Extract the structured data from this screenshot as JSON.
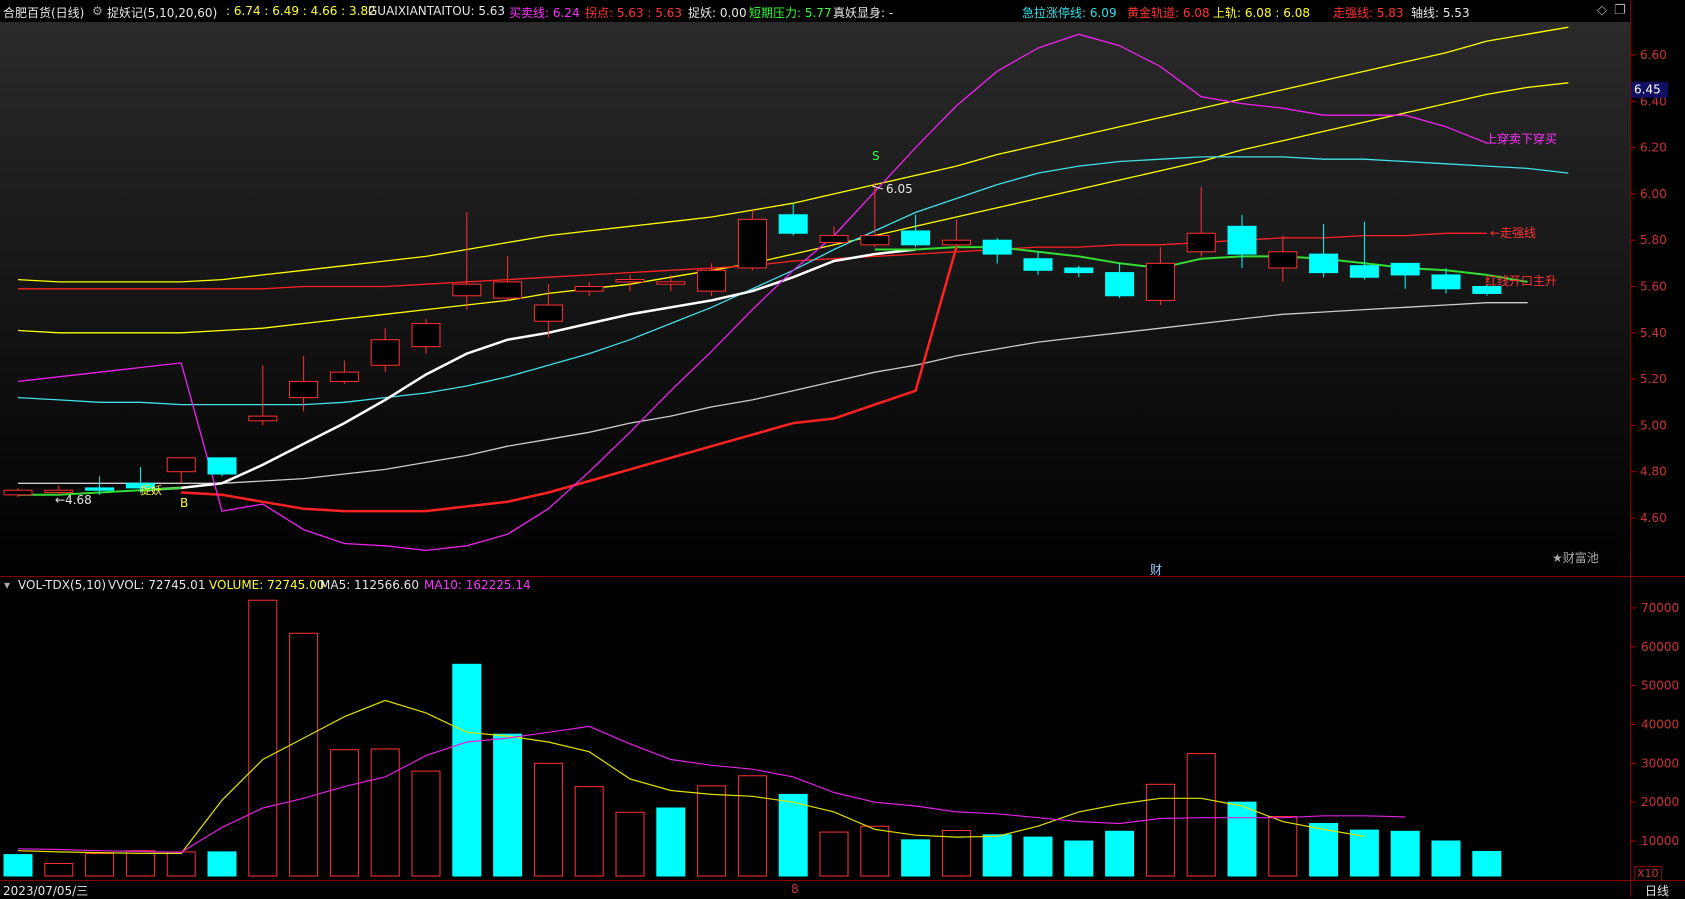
{
  "header": {
    "title": "合肥百货(日线)",
    "indicator": "捉妖记(5,10,20,60)",
    "ma_values": ": 6.74 : 6.49 : 4.66 : 3.82",
    "guaixian": "GUAIXIANTAITOU: 5.63",
    "maimai": "买卖线: 6.24",
    "guaidian": "拐点: 5.63 : 5.63",
    "zhuoyao": "捉妖: 0.00",
    "duanqi": "短期压力: 5.77",
    "zhenyao": "真妖显身: -",
    "jila": "急拉涨停线: 6.09",
    "huangjin": "黄金轨道: 6.08",
    "shanggui": "上轨: 6.08 : 6.08",
    "zouqiang": "走强线: 5.83",
    "zhouxian": "轴线: 5.53"
  },
  "colors": {
    "up": "#ff3232",
    "down": "#00ffff",
    "bg": "#000000",
    "grid": "#7a0000"
  },
  "controls": {
    "diamond_icon": "◇",
    "window_icon": "❐"
  },
  "price_axis": {
    "ticks": [
      "6.60",
      "6.40",
      "6.20",
      "6.00",
      "5.80",
      "5.60",
      "5.40",
      "5.20",
      "5.00",
      "4.80",
      "4.60"
    ],
    "current_price": "6.45"
  },
  "annotations": {
    "shang_chuan": "上穿卖下穿买",
    "zou_qiang": "←走强线",
    "hong_xian": "红线开口主升",
    "low_label": "←4.68",
    "high_label": "6.05",
    "s_marker": "S",
    "b_marker": "B",
    "zhuo_yao": "捉妖",
    "cai": "财",
    "caifuchi": "★财富池"
  },
  "volume_header": {
    "name": "VOL-TDX(5,10)",
    "vvol": "VVOL: 72745.01",
    "volume": "VOLUME: 72745.00",
    "ma5": "MA5: 112566.60",
    "ma10": "MA10: 162225.14"
  },
  "volume_axis": {
    "ticks": [
      "70000",
      "60000",
      "50000",
      "40000",
      "30000",
      "20000",
      "10000"
    ],
    "unit": "X10"
  },
  "footer": {
    "date": "2023/07/05/三",
    "month_marker": "8",
    "period": "日线"
  },
  "chart_data": [
    {
      "type": "candlestick",
      "ylim": [
        4.45,
        6.72
      ],
      "candles": [
        {
          "o": 4.7,
          "c": 4.72,
          "h": 4.73,
          "l": 4.69
        },
        {
          "o": 4.71,
          "c": 4.72,
          "h": 4.74,
          "l": 4.7
        },
        {
          "o": 4.73,
          "c": 4.72,
          "h": 4.78,
          "l": 4.7
        },
        {
          "o": 4.75,
          "c": 4.73,
          "h": 4.82,
          "l": 4.71
        },
        {
          "o": 4.8,
          "c": 4.86,
          "h": 4.86,
          "l": 4.75
        },
        {
          "o": 4.86,
          "c": 4.79,
          "h": 4.86,
          "l": 4.78
        },
        {
          "o": 5.02,
          "c": 5.04,
          "h": 5.26,
          "l": 5.0
        },
        {
          "o": 5.12,
          "c": 5.19,
          "h": 5.3,
          "l": 5.06
        },
        {
          "o": 5.19,
          "c": 5.23,
          "h": 5.28,
          "l": 5.18
        },
        {
          "o": 5.26,
          "c": 5.37,
          "h": 5.42,
          "l": 5.23
        },
        {
          "o": 5.34,
          "c": 5.44,
          "h": 5.46,
          "l": 5.31
        },
        {
          "o": 5.56,
          "c": 5.61,
          "h": 5.92,
          "l": 5.5
        },
        {
          "o": 5.55,
          "c": 5.62,
          "h": 5.73,
          "l": 5.54
        },
        {
          "o": 5.45,
          "c": 5.52,
          "h": 5.61,
          "l": 5.38
        },
        {
          "o": 5.58,
          "c": 5.6,
          "h": 5.62,
          "l": 5.56
        },
        {
          "o": 5.62,
          "c": 5.63,
          "h": 5.65,
          "l": 5.58
        },
        {
          "o": 5.61,
          "c": 5.62,
          "h": 5.65,
          "l": 5.58
        },
        {
          "o": 5.58,
          "c": 5.67,
          "h": 5.7,
          "l": 5.56
        },
        {
          "o": 5.68,
          "c": 5.89,
          "h": 5.93,
          "l": 5.67
        },
        {
          "o": 5.91,
          "c": 5.83,
          "h": 5.96,
          "l": 5.82
        },
        {
          "o": 5.79,
          "c": 5.82,
          "h": 5.86,
          "l": 5.79
        },
        {
          "o": 5.78,
          "c": 5.82,
          "h": 6.05,
          "l": 5.77
        },
        {
          "o": 5.84,
          "c": 5.78,
          "h": 5.91,
          "l": 5.77
        },
        {
          "o": 5.78,
          "c": 5.8,
          "h": 5.89,
          "l": 5.77
        },
        {
          "o": 5.8,
          "c": 5.74,
          "h": 5.81,
          "l": 5.7
        },
        {
          "o": 5.72,
          "c": 5.67,
          "h": 5.75,
          "l": 5.65
        },
        {
          "o": 5.68,
          "c": 5.66,
          "h": 5.69,
          "l": 5.64
        },
        {
          "o": 5.66,
          "c": 5.56,
          "h": 5.7,
          "l": 5.55
        },
        {
          "o": 5.54,
          "c": 5.7,
          "h": 5.77,
          "l": 5.52
        },
        {
          "o": 5.75,
          "c": 5.83,
          "h": 6.03,
          "l": 5.73
        },
        {
          "o": 5.86,
          "c": 5.74,
          "h": 5.91,
          "l": 5.68
        },
        {
          "o": 5.68,
          "c": 5.75,
          "h": 5.82,
          "l": 5.62
        },
        {
          "o": 5.74,
          "c": 5.66,
          "h": 5.87,
          "l": 5.64
        },
        {
          "o": 5.69,
          "c": 5.64,
          "h": 5.88,
          "l": 5.63
        },
        {
          "o": 5.7,
          "c": 5.65,
          "h": 5.7,
          "l": 5.59
        },
        {
          "o": 5.65,
          "c": 5.59,
          "h": 5.68,
          "l": 5.57
        },
        {
          "o": 5.6,
          "c": 5.57,
          "h": 5.61,
          "l": 5.56
        }
      ],
      "lines": [
        {
          "name": "上轨",
          "color": "#ffff00",
          "values": [
            5.63,
            5.62,
            5.62,
            5.62,
            5.62,
            5.63,
            5.65,
            5.67,
            5.69,
            5.71,
            5.73,
            5.76,
            5.79,
            5.82,
            5.84,
            5.86,
            5.88,
            5.9,
            5.93,
            5.96,
            6.0,
            6.04,
            6.08,
            6.12,
            6.17,
            6.21,
            6.25,
            6.29,
            6.33,
            6.37,
            6.41,
            6.45,
            6.49,
            6.53,
            6.57,
            6.61,
            6.66,
            6.69,
            6.72
          ]
        },
        {
          "name": "黄金轨道",
          "color": "#ffff00",
          "values": [
            5.41,
            5.4,
            5.4,
            5.4,
            5.4,
            5.41,
            5.42,
            5.44,
            5.46,
            5.48,
            5.5,
            5.52,
            5.54,
            5.57,
            5.59,
            5.61,
            5.64,
            5.67,
            5.7,
            5.74,
            5.78,
            5.82,
            5.86,
            5.9,
            5.94,
            5.98,
            6.02,
            6.06,
            6.1,
            6.14,
            6.19,
            6.23,
            6.27,
            6.31,
            6.35,
            6.39,
            6.43,
            6.46,
            6.48
          ]
        },
        {
          "name": "走强线",
          "color": "#ff2222",
          "values": [
            5.59,
            5.59,
            5.59,
            5.59,
            5.59,
            5.59,
            5.59,
            5.6,
            5.6,
            5.6,
            5.61,
            5.62,
            5.63,
            5.64,
            5.65,
            5.66,
            5.67,
            5.68,
            5.69,
            5.71,
            5.72,
            5.73,
            5.74,
            5.75,
            5.76,
            5.77,
            5.77,
            5.78,
            5.78,
            5.79,
            5.8,
            5.81,
            5.81,
            5.82,
            5.82,
            5.83,
            5.83
          ]
        },
        {
          "name": "急拉涨停线",
          "color": "#40e0e8",
          "values": [
            5.12,
            5.11,
            5.1,
            5.1,
            5.09,
            5.09,
            5.09,
            5.09,
            5.1,
            5.12,
            5.14,
            5.17,
            5.21,
            5.26,
            5.31,
            5.37,
            5.44,
            5.51,
            5.59,
            5.67,
            5.76,
            5.84,
            5.92,
            5.98,
            6.04,
            6.09,
            6.12,
            6.14,
            6.15,
            6.16,
            6.16,
            6.16,
            6.15,
            6.15,
            6.14,
            6.13,
            6.12,
            6.11,
            6.09
          ]
        },
        {
          "name": "轴线",
          "color": "#cccccc",
          "values": [
            4.75,
            4.75,
            4.75,
            4.75,
            4.75,
            4.75,
            4.76,
            4.77,
            4.79,
            4.81,
            4.84,
            4.87,
            4.91,
            4.94,
            4.97,
            5.01,
            5.04,
            5.08,
            5.11,
            5.15,
            5.19,
            5.23,
            5.26,
            5.3,
            5.33,
            5.36,
            5.38,
            5.4,
            5.42,
            5.44,
            5.46,
            5.48,
            5.49,
            5.5,
            5.51,
            5.52,
            5.53,
            5.53
          ]
        },
        {
          "name": "短期均线",
          "color": "#ffffff",
          "values": [
            null,
            null,
            null,
            4.72,
            4.73,
            4.75,
            4.83,
            4.92,
            5.01,
            5.11,
            5.22,
            5.31,
            5.37,
            5.4,
            5.44,
            5.48,
            5.51,
            5.54,
            5.58,
            5.64,
            5.71,
            5.74,
            5.76
          ]
        },
        {
          "name": "拐点",
          "color": "#33dd33",
          "values": [
            4.7,
            4.7,
            4.71,
            4.72,
            4.73,
            null,
            null,
            null,
            null,
            null,
            null,
            null,
            null,
            null,
            null,
            null,
            null,
            null,
            null,
            null,
            null,
            5.76,
            5.76,
            5.77,
            5.77,
            5.75,
            5.73,
            5.7,
            5.68,
            5.72,
            5.73,
            5.73,
            5.72,
            5.7,
            5.68,
            5.67,
            5.65,
            5.62
          ]
        },
        {
          "name": "红线",
          "color": "#ff2222",
          "values": [
            null,
            null,
            null,
            null,
            4.71,
            4.7,
            4.67,
            4.64,
            4.63,
            4.63,
            4.63,
            4.65,
            4.67,
            4.71,
            4.76,
            4.81,
            4.86,
            4.91,
            4.96,
            5.01,
            5.03,
            5.09,
            5.15,
            5.77
          ]
        },
        {
          "name": "买卖线",
          "color": "#ee22ee",
          "values": [
            5.19,
            5.21,
            5.23,
            5.25,
            5.27,
            4.63,
            4.66,
            4.55,
            4.49,
            4.48,
            4.46,
            4.48,
            4.53,
            4.64,
            4.8,
            4.97,
            5.15,
            5.32,
            5.5,
            5.67,
            5.82,
            6.01,
            6.2,
            6.38,
            6.53,
            6.63,
            6.69,
            6.64,
            6.55,
            6.42,
            6.39,
            6.37,
            6.34,
            6.34,
            6.34,
            6.29,
            6.22
          ]
        }
      ]
    },
    {
      "type": "bar",
      "title": "VOL-TDX(5,10)",
      "ylim": [
        0,
        77000
      ],
      "volumes": [
        6500,
        4200,
        6800,
        7500,
        7200,
        7200,
        72000,
        63500,
        33500,
        33700,
        28000,
        55500,
        37500,
        30000,
        24000,
        17400,
        18500,
        24200,
        26800,
        22000,
        12300,
        13800,
        10300,
        12700,
        11600,
        11000,
        10000,
        12500,
        24600,
        32500,
        20000,
        16300,
        14500,
        12800,
        12500,
        10000,
        7300
      ],
      "down": [
        true,
        false,
        false,
        false,
        false,
        true,
        false,
        false,
        false,
        false,
        false,
        true,
        true,
        false,
        false,
        false,
        true,
        false,
        false,
        true,
        false,
        false,
        true,
        false,
        true,
        true,
        true,
        true,
        false,
        false,
        true,
        false,
        true,
        true,
        true,
        true,
        true
      ],
      "ma5": [
        null,
        null,
        null,
        null,
        6700,
        null,
        null,
        null,
        null,
        null,
        null,
        null,
        null,
        null,
        null,
        null,
        null,
        null,
        null,
        null,
        null,
        null,
        null,
        null,
        null,
        null,
        null,
        null,
        null,
        null,
        null,
        null,
        null,
        null,
        null,
        null,
        null
      ],
      "ma5_series": [
        7500,
        7200,
        7000,
        6800,
        6800,
        20500,
        31000,
        36500,
        42000,
        46200,
        43000,
        38000,
        37000,
        35500,
        33000,
        26000,
        23000,
        22000,
        21500,
        20000,
        17500,
        13000,
        11500,
        11000,
        11200,
        13800,
        17500,
        19500,
        21000,
        21000,
        19000,
        15000,
        13000,
        11200
      ],
      "ma10_series": [
        8000,
        7800,
        7500,
        7300,
        7100,
        13500,
        18500,
        21000,
        24000,
        26500,
        32000,
        35500,
        36500,
        38000,
        39500,
        35000,
        31000,
        29500,
        28500,
        26500,
        22500,
        20000,
        19000,
        17500,
        17000,
        16000,
        15000,
        14500,
        15800,
        16000,
        16000,
        16000,
        16500,
        16500,
        16200
      ]
    }
  ]
}
